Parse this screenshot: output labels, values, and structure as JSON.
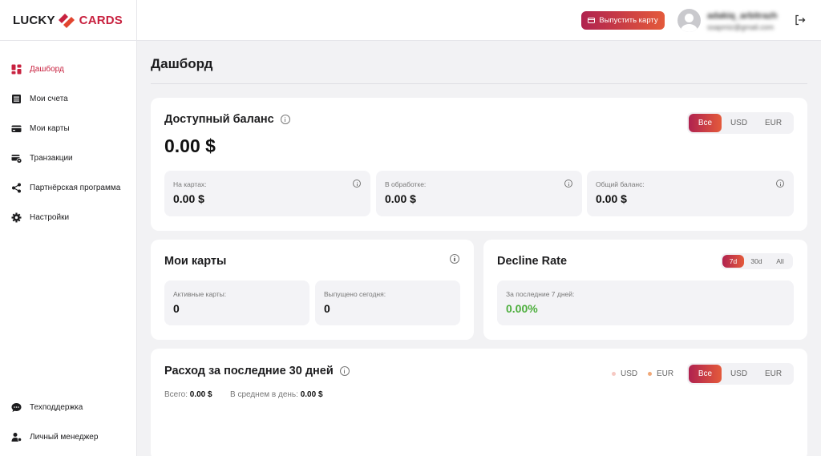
{
  "header": {
    "logo_left": "LUCKY",
    "logo_right": "CARDS",
    "issue_card_label": "Выпустить карту",
    "user_name": "adakiq_arbitrazh",
    "user_email": "ssapmiz@gmail.com"
  },
  "sidebar": {
    "items": [
      {
        "label": "Дашборд"
      },
      {
        "label": "Мои счета"
      },
      {
        "label": "Мои карты"
      },
      {
        "label": "Транзакции"
      },
      {
        "label": "Партнёрская программа"
      },
      {
        "label": "Настройки"
      }
    ],
    "bottom": [
      {
        "label": "Техподдержка"
      },
      {
        "label": "Личный менеджер"
      }
    ]
  },
  "page_title": "Дашборд",
  "balance": {
    "title": "Доступный баланс",
    "amount": "0.00 $",
    "currency_tabs": [
      "Все",
      "USD",
      "EUR"
    ],
    "stats": [
      {
        "label": "На картах:",
        "value": "0.00 $"
      },
      {
        "label": "В обработке:",
        "value": "0.00 $"
      },
      {
        "label": "Общий баланс:",
        "value": "0.00 $"
      }
    ]
  },
  "my_cards": {
    "title": "Мои карты",
    "stats": [
      {
        "label": "Активные карты:",
        "value": "0"
      },
      {
        "label": "Выпущено сегодня:",
        "value": "0"
      }
    ]
  },
  "decline": {
    "title": "Decline Rate",
    "period_tabs": [
      "7d",
      "30d",
      "All"
    ],
    "stat_label": "За последние 7 дней:",
    "stat_value": "0.00%"
  },
  "spending": {
    "title": "Расход за последние 30 дней",
    "legend": [
      {
        "label": "USD",
        "color": "#f6c9c3"
      },
      {
        "label": "EUR",
        "color": "#f0a878"
      }
    ],
    "currency_tabs": [
      "Все",
      "USD",
      "EUR"
    ],
    "total_label": "Всего:",
    "total_value": "0.00 $",
    "avg_label": "В среднем в день:",
    "avg_value": "0.00 $"
  },
  "colors": {
    "accent": "#c8213f",
    "gradient_start": "#b0224f",
    "gradient_end": "#e45a3b",
    "positive": "#4cae3c"
  }
}
